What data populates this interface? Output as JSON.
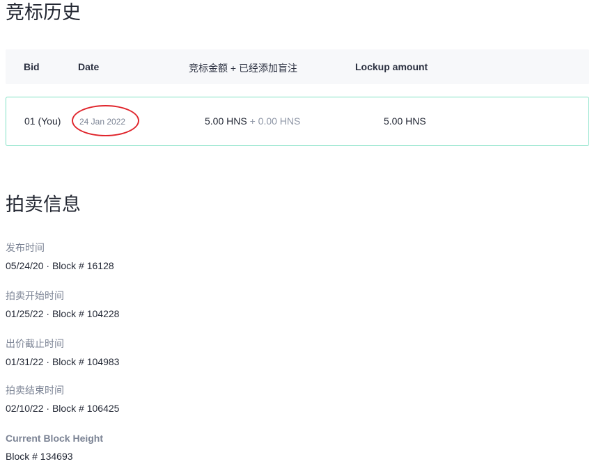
{
  "bid_history": {
    "title": "竞标历史",
    "headers": {
      "bid": "Bid",
      "date": "Date",
      "amount": "竞标金额 + 已经添加盲注",
      "lockup": "Lockup amount"
    },
    "rows": [
      {
        "bid": "01 (You)",
        "date": "24 Jan 2022",
        "amount": "5.00 HNS",
        "blind_added": "+ 0.00 HNS",
        "lockup": "5.00 HNS"
      }
    ]
  },
  "auction_info": {
    "title": "拍卖信息",
    "items": [
      {
        "label": "发布时间",
        "value": "05/24/20 · Block # 16128"
      },
      {
        "label": "拍卖开始时间",
        "value": "01/25/22 · Block # 104228"
      },
      {
        "label": "出价截止时间",
        "value": "01/31/22 · Block # 104983"
      },
      {
        "label": "拍卖结束时间",
        "value": "02/10/22 · Block # 106425"
      },
      {
        "label": "Current Block Height",
        "value": "Block # 134693"
      }
    ]
  },
  "colors": {
    "row_border": "#7fe0c4",
    "annotation": "#e0262d",
    "muted_text": "#7b8394"
  }
}
